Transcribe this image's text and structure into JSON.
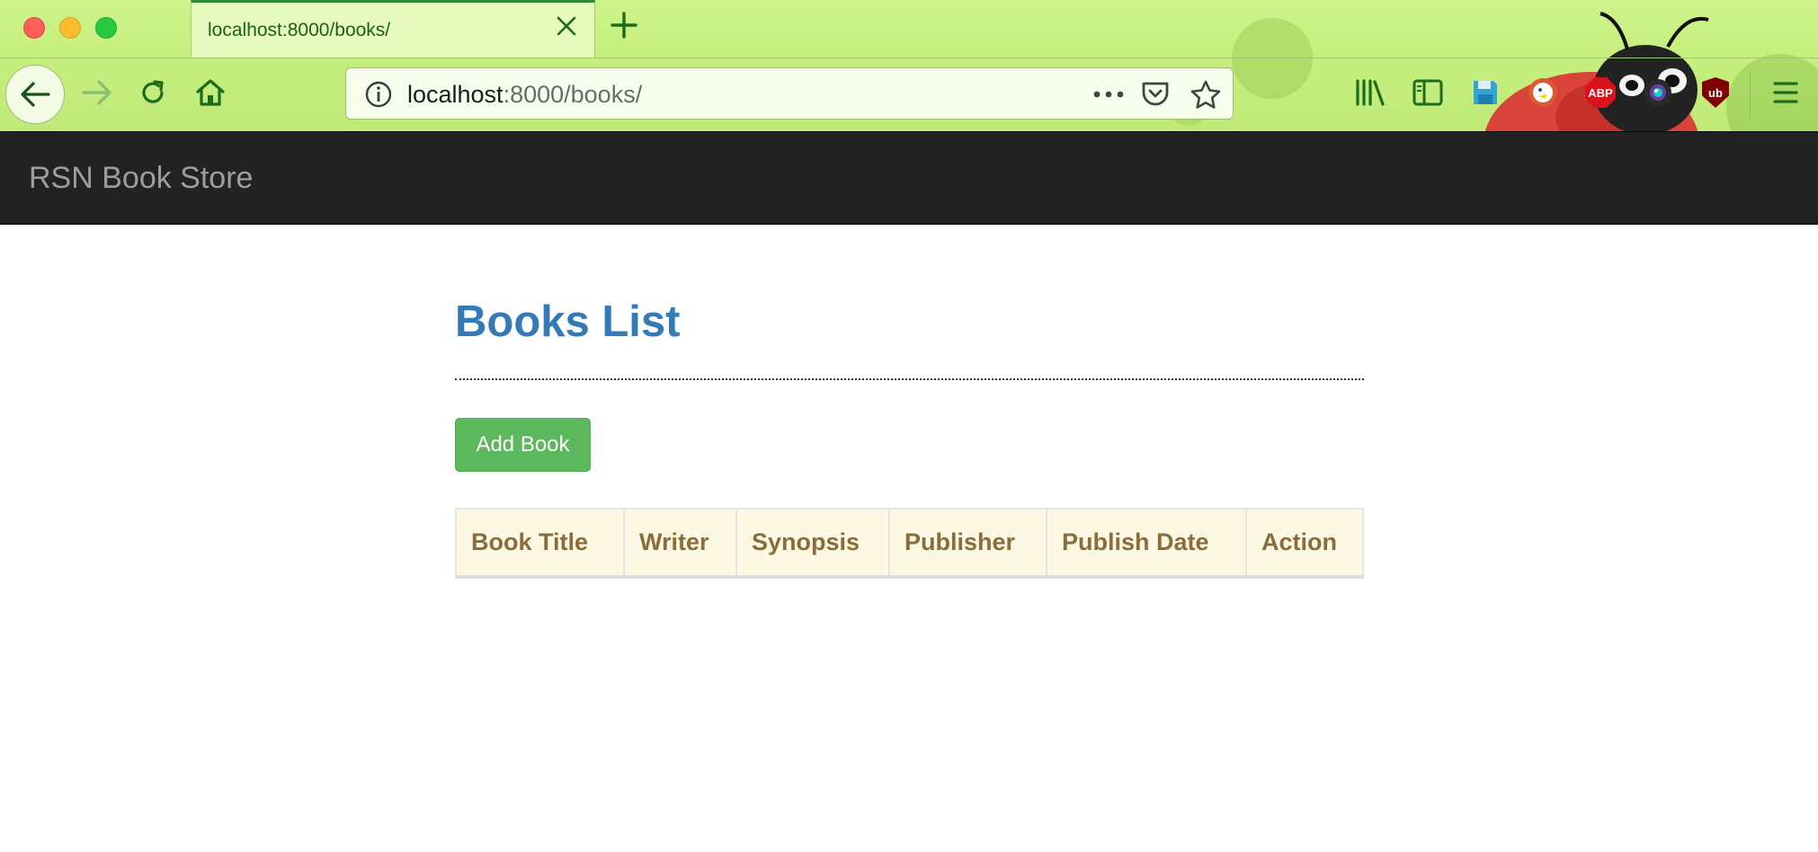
{
  "browser": {
    "tab": {
      "title": "localhost:8000/books/"
    },
    "url": {
      "host": "localhost",
      "rest": ":8000/books/"
    },
    "toolbar_icons": [
      "library-icon",
      "sidebar-icon",
      "save-icon",
      "duckduckgo-icon",
      "adblock-plus-icon",
      "camera-icon",
      "ublock-icon",
      "menu-icon"
    ],
    "abp_label": "ABP",
    "ub_label": "ub"
  },
  "site": {
    "brand": "RSN Book Store"
  },
  "main": {
    "title": "Books List",
    "add_button": "Add Book",
    "table": {
      "columns": [
        "Book Title",
        "Writer",
        "Synopsis",
        "Publisher",
        "Publish Date",
        "Action"
      ],
      "rows": []
    }
  },
  "colors": {
    "navbar_bg": "#222222",
    "brand_text": "#9d9d9d",
    "title": "#337ab7",
    "button_success": "#5cb85c",
    "table_header_bg": "#fcf8e3",
    "table_header_text": "#8a6d3b"
  }
}
